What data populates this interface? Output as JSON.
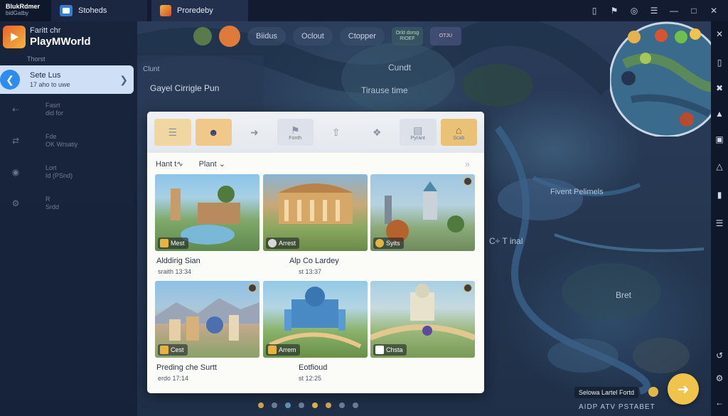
{
  "window": {
    "logo_line1": "BlukRdmer",
    "logo_line2": "bidGatby",
    "tabs": [
      {
        "label": "Stoheds"
      },
      {
        "label": "Proredeby"
      }
    ]
  },
  "sidebar": {
    "app_subtitle": "Faritt chr",
    "app_title": "PlayMWorld",
    "section_label": "Thorst",
    "active_item": {
      "title": "Sete Lus",
      "subtitle": "17 aho to uwe"
    },
    "items": [
      {
        "title": "Fasrt",
        "subtitle": "did for"
      },
      {
        "title": "Fde",
        "subtitle": "OK Wrsatiy"
      },
      {
        "title": "Lort",
        "subtitle": "Id (PSnd)"
      },
      {
        "title": "R",
        "subtitle": "Srdd"
      }
    ]
  },
  "game_nav": {
    "buttons": [
      "Biidus",
      "Oclout",
      "Ctopper"
    ],
    "small_badge": "Orld dorsg RIOEF",
    "small_badge2": "OTJU"
  },
  "subpanel": {
    "label": "Clunt",
    "title": "Gayel Cirrigle Pun"
  },
  "map_labels": {
    "top_center": "Cundt",
    "tirase": "Tirause time",
    "fivent": "Fivent Pelimels",
    "tinal": "C÷ T inal",
    "bret": "Bret"
  },
  "popup": {
    "toolbar": [
      {
        "icon": "map-icon",
        "label": ""
      },
      {
        "icon": "avatar-icon",
        "label": ""
      },
      {
        "icon": "arrow-icon",
        "label": ""
      },
      {
        "icon": "flag-icon",
        "label": "Fonth"
      },
      {
        "icon": "up-arrow-icon",
        "label": ""
      },
      {
        "icon": "tag-icon",
        "label": ""
      },
      {
        "icon": "device-icon",
        "label": "Pyrant"
      },
      {
        "icon": "house-icon",
        "label": "Scab"
      }
    ],
    "filter_left": "Hant t∿",
    "filter_right": "Plant",
    "cards": [
      {
        "tag": "Mest",
        "title": "Alddirig Sian",
        "sub": "sraith 13:34"
      },
      {
        "tag": "Arrest",
        "title": "Alp Co Lardey",
        "sub": "st 13:37"
      },
      {
        "tag": "Syits",
        "title": "",
        "sub": ""
      },
      {
        "tag": "Cest",
        "title": "Preding che Surtt",
        "sub": "erdo 17:14"
      },
      {
        "tag": "Arrem",
        "title": "Eotfioud",
        "sub": "st 12:25"
      },
      {
        "tag": "Chsta",
        "title": "",
        "sub": ""
      }
    ]
  },
  "bottom": {
    "pill_label": "Selowa Lartel Fortd",
    "bottom_text": "AIDP ATV PSTABET"
  }
}
